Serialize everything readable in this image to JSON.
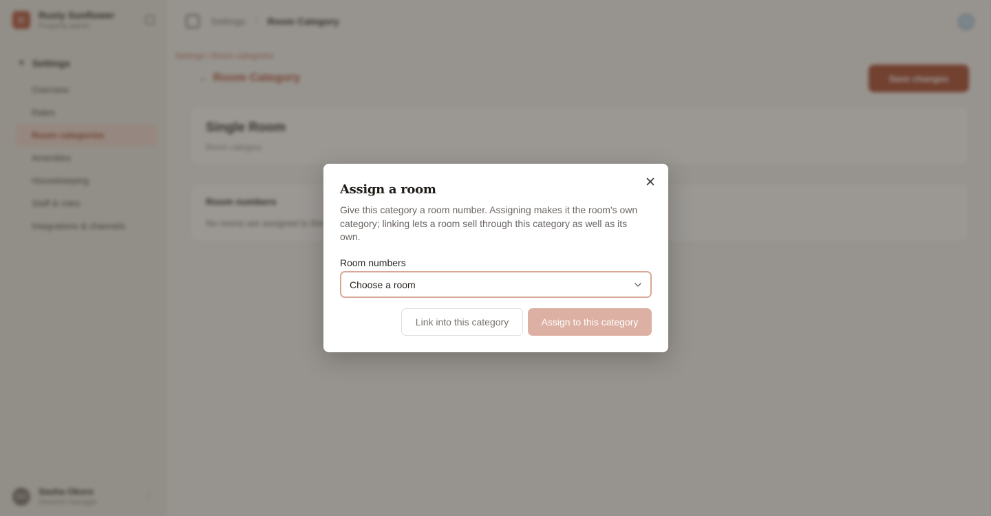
{
  "app": {
    "brand_name": "Rusty Sunflower",
    "brand_sub": "Property admin",
    "brand_mark": "R",
    "sidebar_section": "Settings",
    "sidebar_items": [
      {
        "label": "Overview"
      },
      {
        "label": "Rates"
      },
      {
        "label": "Room categories",
        "active": true
      },
      {
        "label": "Amenities"
      },
      {
        "label": "Housekeeping"
      },
      {
        "label": "Staff & roles"
      },
      {
        "label": "Integrations & channels"
      }
    ],
    "user_initials": "SO",
    "user_name": "Sasha Okoro",
    "user_role": "General manager",
    "topbar_section": "Settings",
    "topbar_current": "Room Category",
    "crumb_links": "Settings / Room categories",
    "back_link": "Room Category",
    "primary_action": "Save changes",
    "card1_title": "Single Room",
    "card1_sub": "Room category",
    "card2_title": "Room numbers",
    "card2_text": "No rooms are assigned to this category yet."
  },
  "modal": {
    "title": "Assign a room",
    "description": "Give this category a room number. Assigning makes it the room's own category; linking lets a room sell through this category as well as its own.",
    "field_label": "Room numbers",
    "select_placeholder": "Choose a room",
    "link_button": "Link into this category",
    "assign_button": "Assign to this category"
  },
  "icons": {
    "close": "close-icon",
    "chevron": "chevron-down-icon"
  },
  "colors": {
    "accent": "#a84a2e",
    "select_border": "#d9a796",
    "assign_disabled": "#dcb0a2"
  }
}
